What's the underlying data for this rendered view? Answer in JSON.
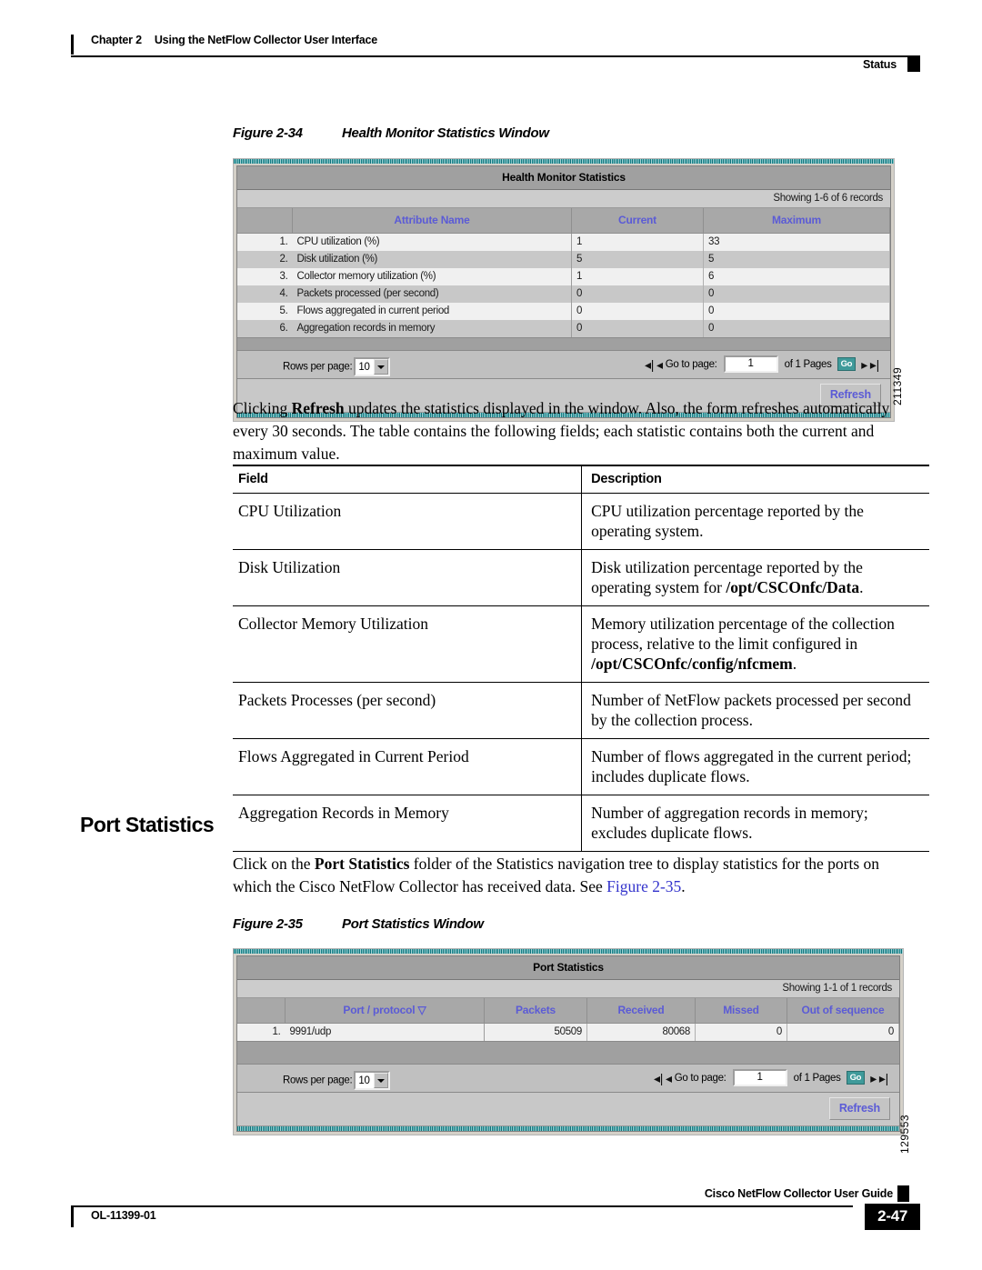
{
  "header": {
    "chapter": "Chapter 2",
    "chapter_title": "Using the NetFlow Collector User Interface",
    "running_head": "Status"
  },
  "figure_34": {
    "caption_number": "Figure 2-34",
    "caption_title": "Health Monitor Statistics Window",
    "figure_id": "211349",
    "window": {
      "title": "Health Monitor Statistics",
      "showing": "Showing 1-6 of 6 records",
      "columns": [
        "",
        "Attribute Name",
        "Current",
        "Maximum"
      ],
      "rows": [
        {
          "index": "1.",
          "attribute": "CPU utilization (%)",
          "current": "1",
          "maximum": "33"
        },
        {
          "index": "2.",
          "attribute": "Disk utilization (%)",
          "current": "5",
          "maximum": "5"
        },
        {
          "index": "3.",
          "attribute": "Collector memory utilization (%)",
          "current": "1",
          "maximum": "6"
        },
        {
          "index": "4.",
          "attribute": "Packets processed (per second)",
          "current": "0",
          "maximum": "0"
        },
        {
          "index": "5.",
          "attribute": "Flows aggregated in current period",
          "current": "0",
          "maximum": "0"
        },
        {
          "index": "6.",
          "attribute": "Aggregation records in memory",
          "current": "0",
          "maximum": "0"
        }
      ],
      "pagination": {
        "rows_per_page_label": "Rows per page:",
        "rows_per_page_value": "10",
        "go_to_page_label": "Go to page:",
        "page_value": "1",
        "of_pages_label": "of 1 Pages",
        "go_button": "Go",
        "first_icon": "first-page-icon",
        "prev_icon": "previous-page-icon",
        "next_icon": "next-page-icon",
        "last_icon": "last-page-icon"
      },
      "refresh_button": "Refresh"
    }
  },
  "paragraph_refresh": {
    "part1": "Clicking ",
    "bold1": "Refresh",
    "part2": " updates the statistics displayed in the window. Also, the form refreshes automatically every 30 seconds. The table contains the following fields; each statistic contains both the current and maximum value."
  },
  "field_table": {
    "headers": [
      "Field",
      "Description"
    ],
    "rows": [
      {
        "field": "CPU Utilization",
        "desc_pre": "CPU utilization percentage reported by the operating system.",
        "desc_bold": "",
        "desc_post": ""
      },
      {
        "field": "Disk Utilization",
        "desc_pre": "Disk utilization percentage reported by the operating system for ",
        "desc_bold": "/opt/CSCOnfc/Data",
        "desc_post": "."
      },
      {
        "field": "Collector Memory Utilization",
        "desc_pre": " Memory utilization percentage of the collection process, relative to the limit configured in ",
        "desc_bold": "/opt/CSCOnfc/config/nfcmem",
        "desc_post": "."
      },
      {
        "field": "Packets Processes (per second)",
        "desc_pre": "Number of NetFlow packets processed per second by the collection process.",
        "desc_bold": "",
        "desc_post": ""
      },
      {
        "field": "Flows Aggregated in Current Period",
        "desc_pre": "Number of flows aggregated in the current period; includes duplicate flows.",
        "desc_bold": "",
        "desc_post": ""
      },
      {
        "field": "Aggregation Records in Memory",
        "desc_pre": " Number of aggregation records in memory; excludes duplicate flows.",
        "desc_bold": "",
        "desc_post": ""
      }
    ]
  },
  "section": {
    "heading": "Port Statistics",
    "para_part1": "Click on the ",
    "para_bold1": "Port Statistics",
    "para_part2": " folder of the Statistics navigation tree to display statistics for the ports on which the Cisco NetFlow Collector has received data. See ",
    "para_xref": "Figure 2-35",
    "para_part3": "."
  },
  "figure_35": {
    "caption_number": "Figure 2-35",
    "caption_title": "Port Statistics Window",
    "figure_id": "129553",
    "window": {
      "title": "Port Statistics",
      "showing": "Showing 1-1 of 1 records",
      "columns": [
        "",
        "Port / protocol",
        "Packets",
        "Received",
        "Missed",
        "Out of sequence"
      ],
      "sort_indicator": "sort-descending-icon",
      "rows": [
        {
          "index": "1.",
          "port_protocol": "9991/udp",
          "packets": "50509",
          "received": "80068",
          "missed": "0",
          "out_of_sequence": "0"
        }
      ],
      "pagination": {
        "rows_per_page_label": "Rows per page:",
        "rows_per_page_value": "10",
        "go_to_page_label": "Go to page:",
        "page_value": "1",
        "of_pages_label": "of 1 Pages",
        "go_button": "Go"
      },
      "refresh_button": "Refresh"
    }
  },
  "footer": {
    "guide_title": "Cisco NetFlow Collector User Guide",
    "doc_id": "OL-11399-01",
    "page_number": "2-47"
  },
  "colors": {
    "header_link": "#5b5bd6",
    "xref": "#3333cc",
    "window_chrome": "#c0c0c0",
    "title_bar": "#a0a0a0",
    "stripe": "#0d8a8a",
    "go_button": "#3f9a9a"
  }
}
